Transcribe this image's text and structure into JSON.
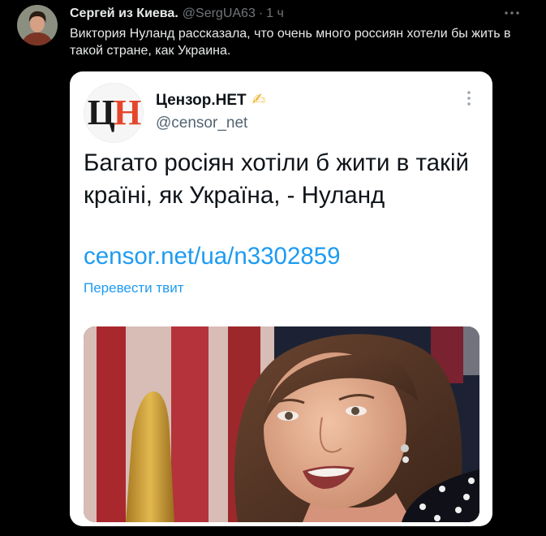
{
  "colors": {
    "background": "#000000",
    "text": "#e7e9ea",
    "muted": "#71767b",
    "card": "#ffffff",
    "card_text": "#0f1419",
    "card_muted": "#536471",
    "link": "#1d9bf0",
    "logo_red": "#e4462c"
  },
  "tweet": {
    "avatar_icon": "user-avatar-icon",
    "author_name": "Сергей из Киева.",
    "handle": "@SergUA63",
    "separator": "·",
    "time": "1 ч",
    "more_icon": "more-horizontal-icon",
    "text": "Виктория Нуланд рассказала, что очень много россиян хотели бы жить в такой стране, как Украина."
  },
  "embedded_tweet": {
    "logo_letters": [
      "Ц",
      "Н"
    ],
    "name": "Цензор.НЕТ",
    "name_emoji": "✍",
    "handle": "@censor_net",
    "more_icon": "more-vertical-icon",
    "text": "Багато росіян хотіли б жити в такій країні, як Україна, - Нуланд",
    "link": "censor.net/ua/n3302859",
    "translate_label": "Перевести твит"
  }
}
